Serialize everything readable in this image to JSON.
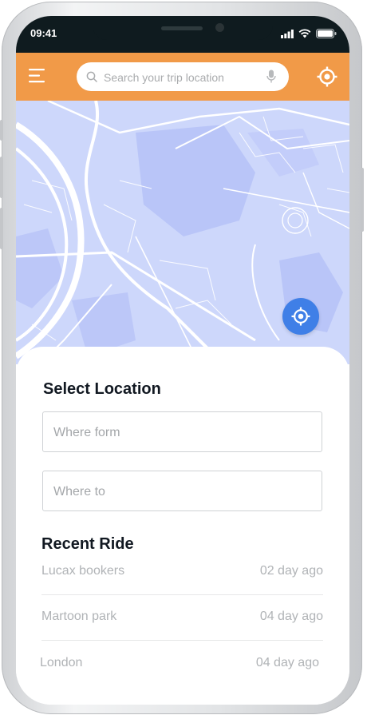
{
  "status_bar": {
    "time": "09:41"
  },
  "header": {
    "search_placeholder": "Search your trip location",
    "menu_icon": "hamburger-menu-icon",
    "mic_icon": "microphone-icon",
    "locate_icon": "crosshair-locate-icon"
  },
  "map": {
    "locate_icon": "crosshair-locate-icon"
  },
  "select_location": {
    "title": "Select Location",
    "from_placeholder": "Where form",
    "to_placeholder": "Where to"
  },
  "recent_ride": {
    "title": "Recent Ride",
    "items": [
      {
        "name": "Lucax bookers",
        "time": "02 day ago"
      },
      {
        "name": "Martoon park",
        "time": "04 day ago"
      },
      {
        "name": "London",
        "time": "04 day ago"
      }
    ]
  },
  "colors": {
    "header": "#f19a48",
    "map_background": "#cdd7fb",
    "locate_button": "#3f7fe7",
    "status_bar": "#0f1b1f"
  }
}
